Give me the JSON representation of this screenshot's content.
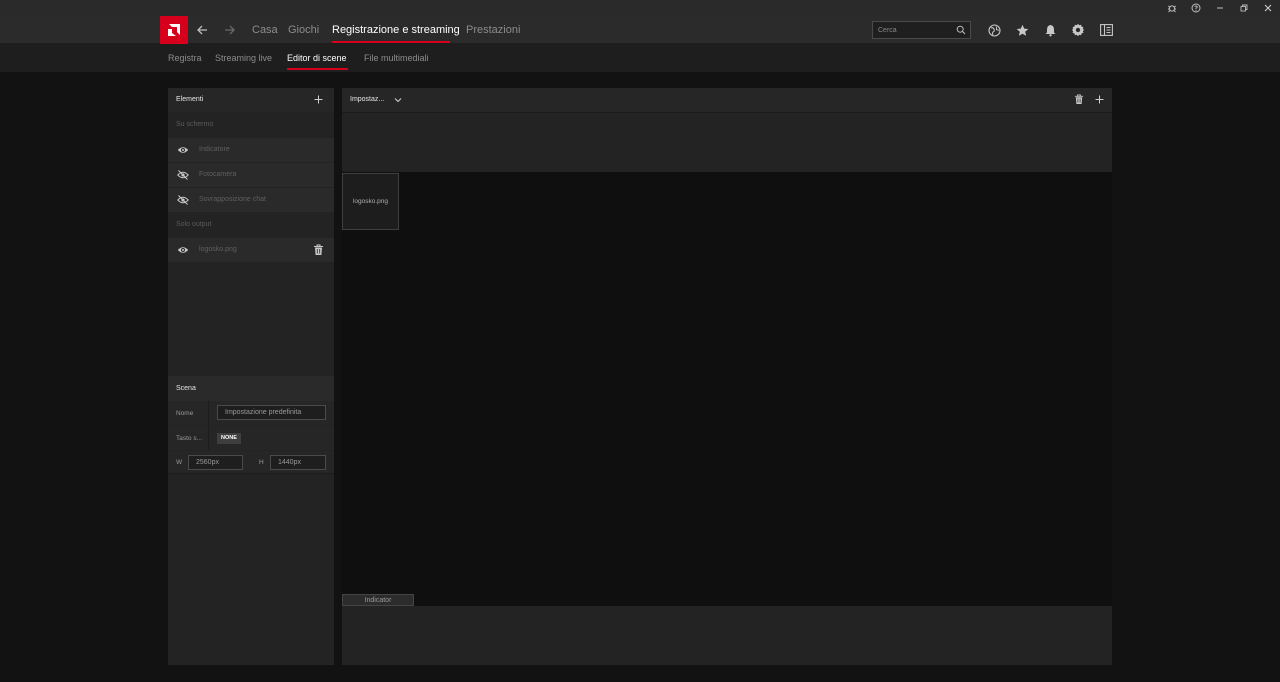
{
  "nav": {
    "items": [
      "Casa",
      "Giochi",
      "Registrazione e streaming",
      "Prestazioni"
    ],
    "active": "Registrazione e streaming"
  },
  "search": {
    "placeholder": "Cerca"
  },
  "subnav": {
    "items": [
      "Registra",
      "Streaming live",
      "Editor di scene",
      "File multimediali"
    ],
    "active": "Editor di scene"
  },
  "elements_panel": {
    "title": "Elementi",
    "on_screen_label": "Su schermo",
    "on_screen_items": [
      {
        "label": "Indicatore",
        "icon": "eye-icon"
      },
      {
        "label": "Fotocamera",
        "icon": "eye-off-icon"
      },
      {
        "label": "Sovrapposizione chat",
        "icon": "eye-off-icon"
      }
    ],
    "output_only_label": "Solo output",
    "output_only_items": [
      {
        "label": "logosko.png",
        "icon": "eye-icon"
      }
    ]
  },
  "scene_panel": {
    "title": "Scena",
    "name_label": "Nome",
    "name_value": "Impostazione predefinita",
    "hotkey_label": "Tasto s...",
    "hotkey_value": "NONE",
    "width_label": "W",
    "width_value": "2560px",
    "height_label": "H",
    "height_value": "1440px"
  },
  "scene_editor": {
    "scene_selector": "Impostaz...",
    "canvas_item": "logosko.png",
    "bottom_tab": "Indicator"
  },
  "colors": {
    "accent": "#d6001c",
    "background": "#121212",
    "panel": "#232323"
  }
}
